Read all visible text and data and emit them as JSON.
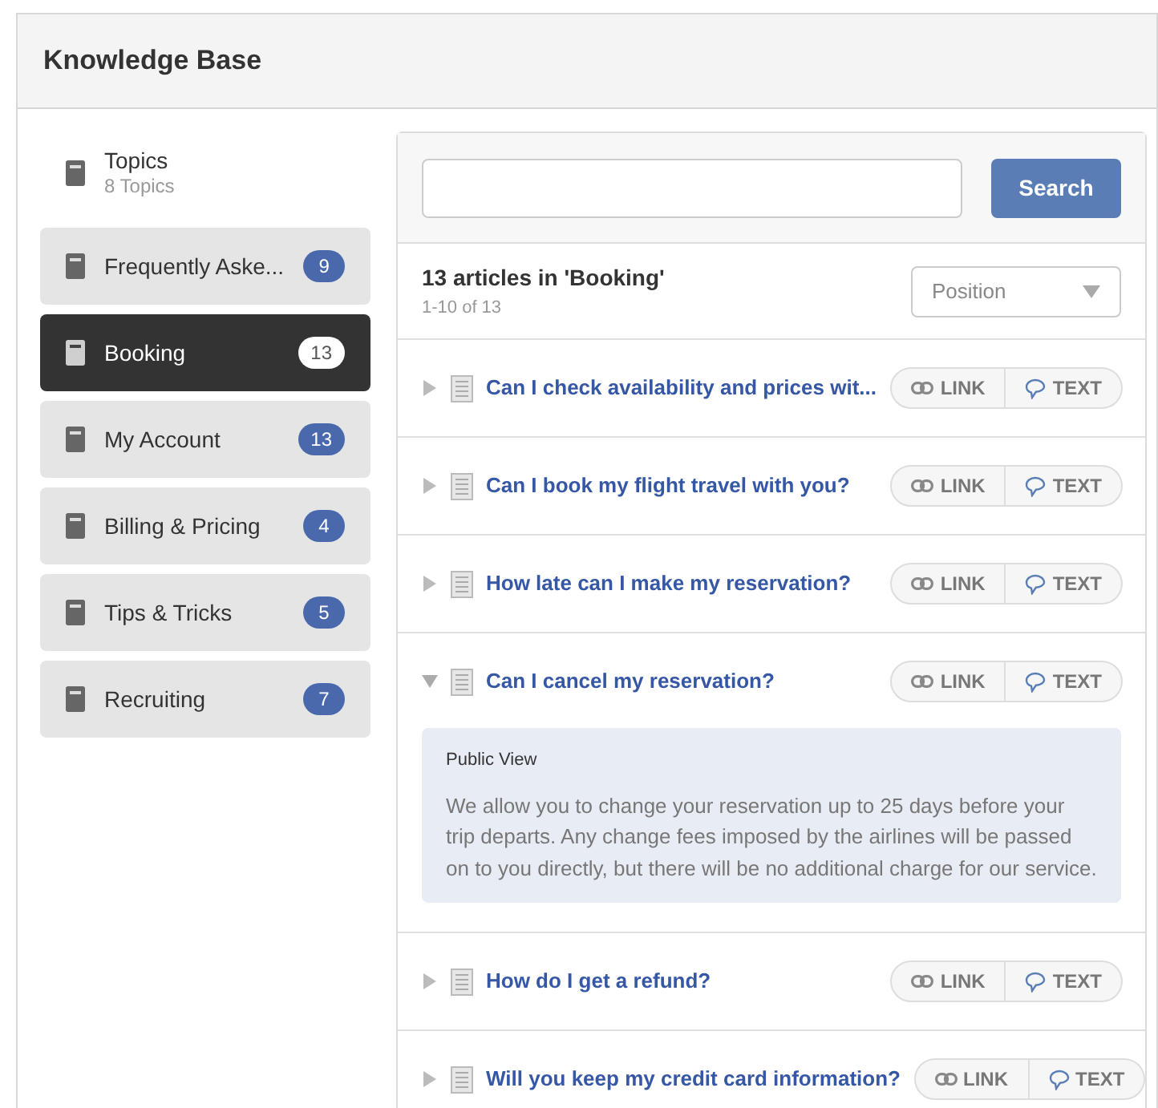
{
  "header": {
    "title": "Knowledge Base"
  },
  "sidebar": {
    "title": "Topics",
    "subtitle": "8 Topics",
    "items": [
      {
        "label": "Frequently Aske...",
        "count": "9",
        "selected": false
      },
      {
        "label": "Booking",
        "count": "13",
        "selected": true
      },
      {
        "label": "My Account",
        "count": "13",
        "selected": false
      },
      {
        "label": "Billing & Pricing",
        "count": "4",
        "selected": false
      },
      {
        "label": "Tips & Tricks",
        "count": "5",
        "selected": false
      },
      {
        "label": "Recruiting",
        "count": "7",
        "selected": false
      }
    ]
  },
  "search": {
    "button": "Search"
  },
  "list": {
    "title": "13 articles in 'Booking'",
    "range": "1-10 of 13",
    "sort": "Position"
  },
  "articles": [
    {
      "title": "Can I check availability and prices wit...",
      "expanded": false,
      "link": "LINK",
      "text": "TEXT"
    },
    {
      "title": "Can I book my flight travel with you?",
      "expanded": false,
      "link": "LINK",
      "text": "TEXT"
    },
    {
      "title": "How late can I make my reservation?",
      "expanded": false,
      "link": "LINK",
      "text": "TEXT"
    },
    {
      "title": "Can I cancel my reservation?",
      "expanded": true,
      "link": "LINK",
      "text": "TEXT",
      "detail": {
        "label": "Public View",
        "body": "We allow you to change your reservation up to 25 days before your trip departs. Any change fees imposed by the airlines will be passed on to you directly, but there will be no additional charge for our service."
      }
    },
    {
      "title": "How do I get a refund?",
      "expanded": false,
      "link": "LINK",
      "text": "TEXT"
    },
    {
      "title": "Will you keep my credit card information?",
      "expanded": false,
      "link": "LINK",
      "text": "TEXT"
    }
  ]
}
